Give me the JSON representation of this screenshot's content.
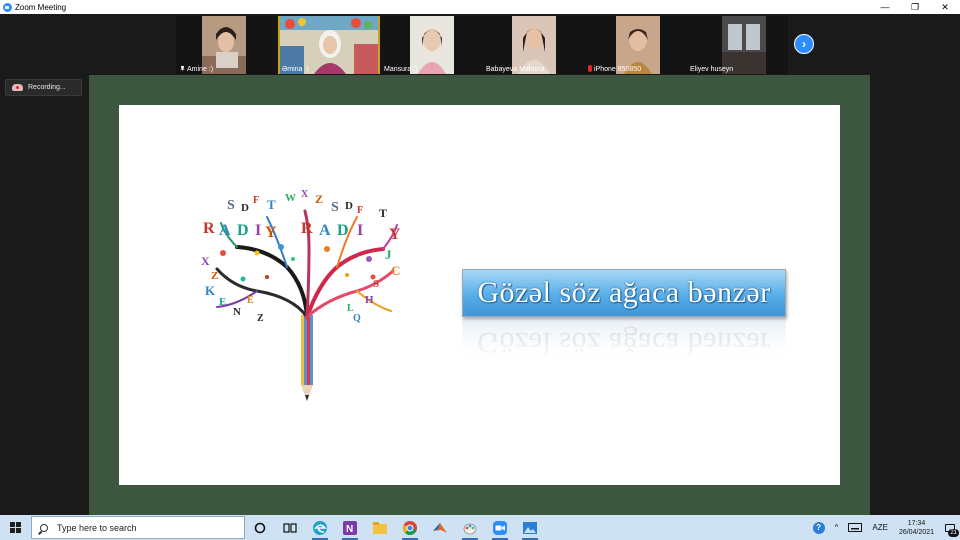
{
  "window": {
    "title": "Zoom Meeting",
    "minimize_glyph": "—",
    "restore_glyph": "❐",
    "close_glyph": "✕"
  },
  "participants": [
    {
      "name": "Amine :)",
      "indicator": "pin-icon"
    },
    {
      "name": "Əmina :)",
      "indicator": "",
      "active": true
    },
    {
      "name": "Mansura :)",
      "indicator": ""
    },
    {
      "name": "Babayeva Mahuna",
      "indicator": ""
    },
    {
      "name": "iPhone 850850",
      "indicator": "mic-muted-icon"
    },
    {
      "name": "Eliyev huseyn",
      "indicator": ""
    }
  ],
  "next_participants_glyph": "›",
  "recording": {
    "label": "Recording..."
  },
  "slide": {
    "banner_text": "Gözəl söz ağaca bənzər",
    "tree_letters": [
      "S",
      "D",
      "F",
      "T",
      "W",
      "X",
      "Z",
      "S",
      "D",
      "F",
      "T",
      "R",
      "A",
      "D",
      "I",
      "Y",
      "R",
      "A",
      "D",
      "I",
      "Y",
      "J",
      "C",
      "X",
      "Z",
      "K",
      "E",
      "N",
      "S",
      "H",
      "L",
      "E",
      "Q",
      "Z"
    ]
  },
  "taskbar": {
    "search_placeholder": "Type here to search",
    "language": "AZE",
    "time": "17:34",
    "date": "26/04/2021",
    "notification_count": "21",
    "help_glyph": "?",
    "chevron_glyph": "^"
  },
  "colors": {
    "zoom_blue": "#2d8cff",
    "share_border": "#3c5640",
    "active_speaker": "#c8a318",
    "banner_blue": "#57aee8"
  }
}
